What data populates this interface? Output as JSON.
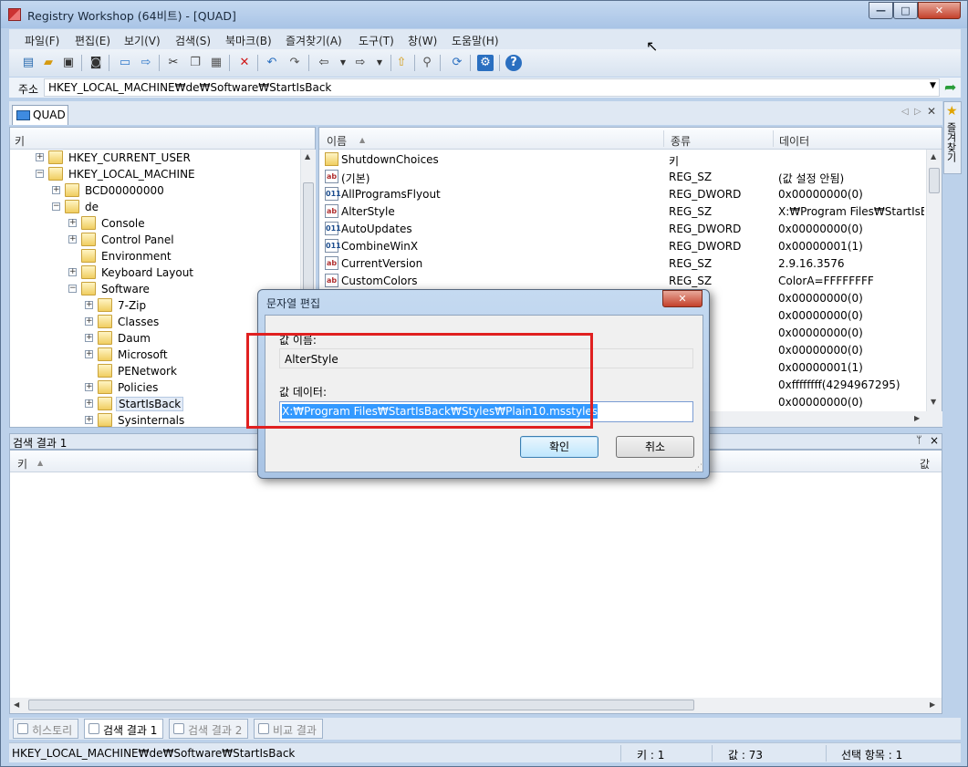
{
  "window": {
    "title": "Registry Workshop (64비트) - [QUAD]",
    "controls": {
      "minimize": "—",
      "maximize": "□",
      "close": "✕"
    }
  },
  "menu": [
    "파일(F)",
    "편집(E)",
    "보기(V)",
    "검색(S)",
    "북마크(B)",
    "즐겨찾기(A)",
    "도구(T)",
    "창(W)",
    "도움말(H)"
  ],
  "toolbar_icons": [
    "new-icon",
    "open-icon",
    "save-icon",
    "camera-icon",
    "computer-icon",
    "connect-icon",
    "cut-icon",
    "copy-icon",
    "paste-icon",
    "delete-icon",
    "undo-icon",
    "redo-icon",
    "back-icon",
    "forward-icon",
    "up-icon",
    "find-icon",
    "refresh-icon",
    "settings-icon",
    "help-icon"
  ],
  "address": {
    "label": "주소",
    "value": "HKEY_LOCAL_MACHINE₩de₩Software₩StartIsBack"
  },
  "doc_tab": {
    "label": "QUAD"
  },
  "favorites": {
    "label": "즐겨찾기"
  },
  "tree": {
    "header": "키",
    "rows": [
      {
        "label": "HKEY_CURRENT_USER",
        "exp": "+"
      },
      {
        "label": "HKEY_LOCAL_MACHINE",
        "exp": "−"
      },
      {
        "label": "BCD00000000",
        "exp": "+"
      },
      {
        "label": "de",
        "exp": "−"
      },
      {
        "label": "Console",
        "exp": "+"
      },
      {
        "label": "Control Panel",
        "exp": "+"
      },
      {
        "label": "Environment",
        "exp": ""
      },
      {
        "label": "Keyboard Layout",
        "exp": "+"
      },
      {
        "label": "Software",
        "exp": "−"
      },
      {
        "label": "7-Zip",
        "exp": "+"
      },
      {
        "label": "Classes",
        "exp": "+"
      },
      {
        "label": "Daum",
        "exp": "+"
      },
      {
        "label": "Microsoft",
        "exp": "+"
      },
      {
        "label": "PENetwork",
        "exp": ""
      },
      {
        "label": "Policies",
        "exp": "+"
      },
      {
        "label": "StartIsBack",
        "exp": "+"
      },
      {
        "label": "Sysinternals",
        "exp": "+"
      }
    ]
  },
  "list": {
    "headers": {
      "name": "이름",
      "type": "종류",
      "data": "데이터"
    },
    "rows": [
      {
        "kind": "key",
        "name": "ShutdownChoices",
        "type": "키",
        "data": ""
      },
      {
        "kind": "sz",
        "name": "(기본)",
        "type": "REG_SZ",
        "data": "(값 설정 안됨)"
      },
      {
        "kind": "dw",
        "name": "AllProgramsFlyout",
        "type": "REG_DWORD",
        "data": "0x00000000(0)"
      },
      {
        "kind": "sz",
        "name": "AlterStyle",
        "type": "REG_SZ",
        "data": "X:₩Program Files₩StartIsBack₩"
      },
      {
        "kind": "dw",
        "name": "AutoUpdates",
        "type": "REG_DWORD",
        "data": "0x00000000(0)"
      },
      {
        "kind": "dw",
        "name": "CombineWinX",
        "type": "REG_DWORD",
        "data": "0x00000001(1)"
      },
      {
        "kind": "sz",
        "name": "CurrentVersion",
        "type": "REG_SZ",
        "data": "2.9.16.3576"
      },
      {
        "kind": "sz",
        "name": "CustomColors",
        "type": "REG_SZ",
        "data": "ColorA=FFFFFFFF"
      },
      {
        "kind": "dw",
        "name": "",
        "type": "ORD",
        "data": "0x00000000(0)"
      },
      {
        "kind": "dw",
        "name": "",
        "type": "ORD",
        "data": "0x00000000(0)"
      },
      {
        "kind": "dw",
        "name": "",
        "type": "ORD",
        "data": "0x00000000(0)"
      },
      {
        "kind": "dw",
        "name": "",
        "type": "ORD",
        "data": "0x00000000(0)"
      },
      {
        "kind": "dw",
        "name": "",
        "type": "ORD",
        "data": "0x00000001(1)"
      },
      {
        "kind": "dw",
        "name": "",
        "type": "ORD",
        "data": "0xffffffff(4294967295)"
      },
      {
        "kind": "dw",
        "name": "",
        "type": "ORD",
        "data": "0x00000000(0)"
      }
    ]
  },
  "results": {
    "title": "검색 결과 1",
    "pin": "ᛘ",
    "close": "×",
    "col_key": "키",
    "col_value": "값"
  },
  "bottom_tabs": [
    "히스토리",
    "검색 결과 1",
    "검색 결과 2",
    "비교 결과"
  ],
  "status": {
    "path": "HKEY_LOCAL_MACHINE₩de₩Software₩StartIsBack",
    "keys": "키 : 1",
    "values": "값 : 73",
    "selected": "선택 항목 : 1"
  },
  "dialog": {
    "title": "문자열 편집",
    "name_label": "값 이름:",
    "name_value": "AlterStyle",
    "data_label": "값 데이터:",
    "data_value": "X:₩Program Files₩StartIsBack₩Styles₩Plain10.msstyles",
    "ok": "확인",
    "cancel": "취소"
  },
  "colors": {
    "accent": "#3399ff",
    "highlight_box": "#e02020",
    "title_bar": "#a9c4e6"
  }
}
